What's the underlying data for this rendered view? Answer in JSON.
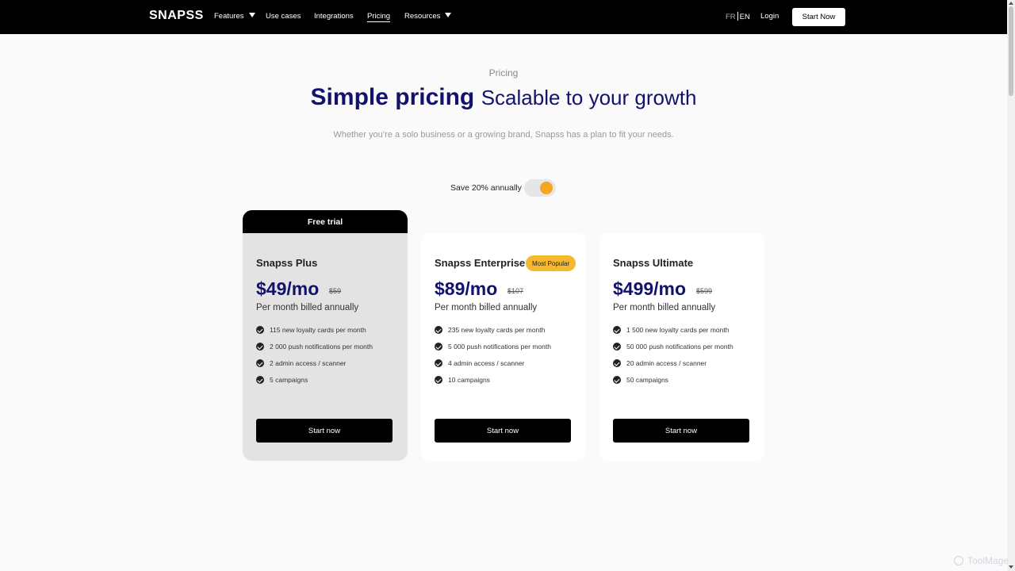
{
  "nav": {
    "logo": "SNAPSS",
    "items": [
      {
        "label": "Features"
      },
      {
        "label": "Use cases"
      },
      {
        "label": "Integrations"
      },
      {
        "label": "Pricing"
      },
      {
        "label": "Resources"
      }
    ],
    "lang_fr": "FR",
    "lang_en": "EN",
    "login": "Login",
    "start_now": "Start Now"
  },
  "header": {
    "eyebrow": "Pricing",
    "title_strong": "Simple pricing",
    "title_light": "Scalable to your growth",
    "subtitle": "Whether you’re a solo business or a growing brand, Snapss has a plan to fit your needs."
  },
  "billing_toggle": {
    "label": "Save 20% annually",
    "annual_on": true,
    "accent_color": "#f5a623"
  },
  "plans": [
    {
      "banner": "Free trial",
      "name": "Snapss Plus",
      "price": "$49/mo",
      "old_price": "$59",
      "billed": "Per month billed annually",
      "features": [
        "115 new loyalty cards per month",
        "2 000 push notifications per month",
        "2 admin access / scanner",
        "5 campaigns"
      ],
      "cta": "Start now"
    },
    {
      "name": "Snapss Enterprise",
      "badge": "Most Popular",
      "price": "$89/mo",
      "old_price": "$107",
      "billed": "Per month billed annually",
      "features": [
        "235 new loyalty cards per month",
        "5 000 push notifications per month",
        "4 admin access / scanner",
        "10 campaigns"
      ],
      "cta": "Start now"
    },
    {
      "name": "Snapss Ultimate",
      "price": "$499/mo",
      "old_price": "$599",
      "billed": "Per month billed annually",
      "features": [
        "1 500 new loyalty cards per month",
        "50 000 push notifications per month",
        "20 admin access / scanner",
        "50 campaigns"
      ],
      "cta": "Start now"
    }
  ],
  "watermark": "ToolMage",
  "colors": {
    "brand_navy": "#12126e",
    "nav_bg": "#000000",
    "badge": "#f5b82e"
  }
}
